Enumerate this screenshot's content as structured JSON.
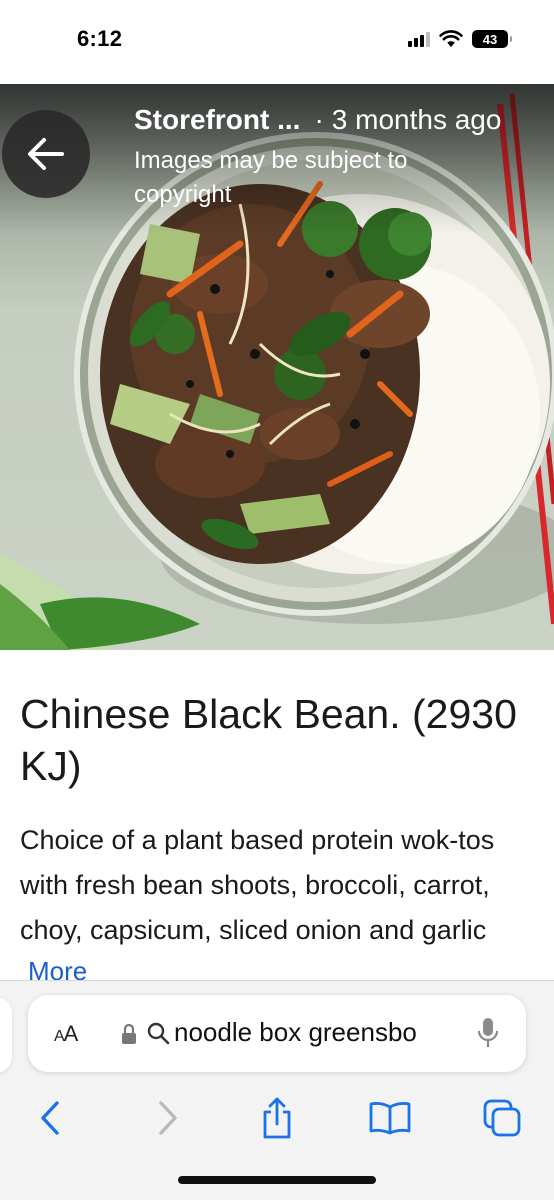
{
  "status_bar": {
    "time": "6:12",
    "battery": "43"
  },
  "image_viewer": {
    "source_name": "Storefront ...",
    "separator": "·",
    "age": "3 months ago",
    "copyright_notice": "Images may be subject to copyright"
  },
  "result": {
    "title": "Chinese Black Bean. (2930 KJ)",
    "description_lines": [
      "Choice of a plant based protein wok-tos",
      "with fresh bean shoots, broccoli, carrot,",
      "choy, capsicum, sliced onion and garlic"
    ],
    "more_label": "More"
  },
  "browser": {
    "text_size_label": "AA",
    "url": "noodle box greensbo"
  },
  "colors": {
    "link": "#1a5fcf",
    "toolbar_icons": "#1a73e8",
    "disabled": "#b9b9b9"
  }
}
